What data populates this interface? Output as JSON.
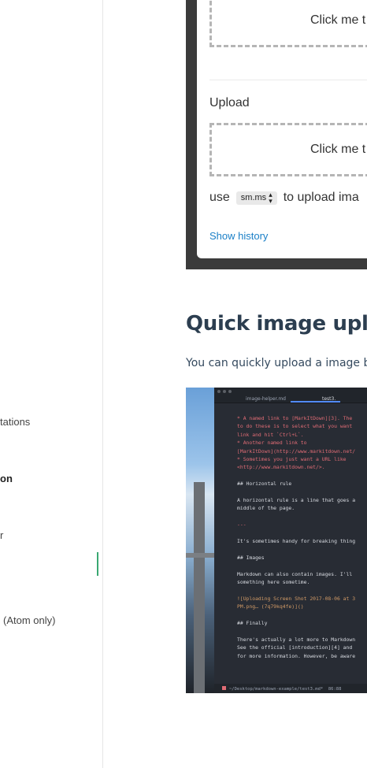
{
  "sidebar": {
    "items": [
      {
        "label": "tations"
      },
      {
        "label": "on"
      },
      {
        "label": "r"
      },
      {
        "label": "(Atom only)"
      }
    ]
  },
  "dialog": {
    "dropzone_text": "Click me t",
    "upload_label": "Upload",
    "upload_dropzone_text": "Click me t",
    "use_prefix": "use",
    "provider_select_value": "sm.ms",
    "use_suffix": "to upload ima",
    "show_history": "Show history"
  },
  "section": {
    "title": "Quick image upload",
    "intro": "You can quickly upload a image by ju"
  },
  "editor": {
    "tab_inactive": "image-helper.md",
    "tab_active": "test3.",
    "lines": [
      {
        "cls": "c-red",
        "text": "* A named link to [MarkItDown][3]. The"
      },
      {
        "cls": "c-red",
        "text": "to do these is to select what you want"
      },
      {
        "cls": "c-red",
        "text": "link and hit `Ctrl+L`."
      },
      {
        "cls": "c-red",
        "text": "* Another named link to"
      },
      {
        "cls": "c-red",
        "text": "[MarkItDown](http://www.markitdown.net/"
      },
      {
        "cls": "c-red",
        "text": "* Sometimes you just want a URL like"
      },
      {
        "cls": "c-red",
        "text": "<http://www.markitdown.net/>."
      },
      {
        "cls": "c-white",
        "text": ""
      },
      {
        "cls": "c-white",
        "text": "## Horizontal rule"
      },
      {
        "cls": "c-white",
        "text": ""
      },
      {
        "cls": "c-white",
        "text": "A horizontal rule is a line that goes a"
      },
      {
        "cls": "c-white",
        "text": "middle of the page."
      },
      {
        "cls": "c-white",
        "text": ""
      },
      {
        "cls": "c-red",
        "text": "---"
      },
      {
        "cls": "c-white",
        "text": ""
      },
      {
        "cls": "c-white",
        "text": "It's sometimes handy for breaking thing"
      },
      {
        "cls": "c-white",
        "text": ""
      },
      {
        "cls": "c-white",
        "text": "## Images"
      },
      {
        "cls": "c-white",
        "text": ""
      },
      {
        "cls": "c-white",
        "text": "Markdown can also contain images. I'll"
      },
      {
        "cls": "c-white",
        "text": "something here sometime."
      },
      {
        "cls": "c-white",
        "text": ""
      },
      {
        "cls": "c-orange",
        "text": "![Uploading Screen Shot 2017-08-06 at 3"
      },
      {
        "cls": "c-orange",
        "text": "PM.png… (7q79kq4fe)]()"
      },
      {
        "cls": "c-white",
        "text": ""
      },
      {
        "cls": "c-white",
        "text": "## Finally"
      },
      {
        "cls": "c-white",
        "text": ""
      },
      {
        "cls": "c-white",
        "text": "There's actually a lot more to Markdown"
      },
      {
        "cls": "c-white",
        "text": "See the official [introduction][4] and"
      },
      {
        "cls": "c-white",
        "text": "for more information. However, be aware"
      }
    ],
    "status_path": "~/Desktop/markdown-example/test3.md*",
    "status_pos": "86:88"
  }
}
